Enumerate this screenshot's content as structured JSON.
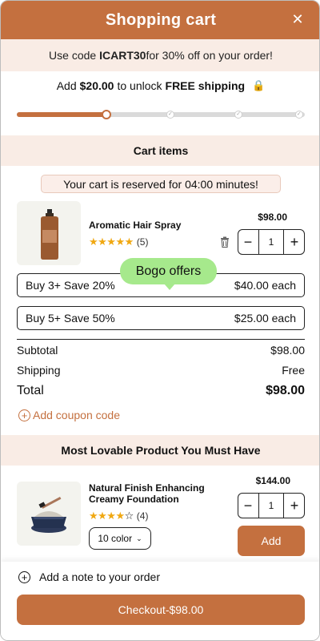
{
  "header": {
    "title": "Shopping cart",
    "close_icon": "close-icon"
  },
  "promo": {
    "prefix": "Use code ",
    "code": "ICART30",
    "suffix": " for 30% off on your order!"
  },
  "shipping": {
    "prefix": "Add",
    "amount": "$20.00",
    "middle": "to unlock",
    "emphasis": "FREE shipping",
    "icon": "lock-icon",
    "progress_percent": 31
  },
  "cart": {
    "section_title": "Cart items",
    "reserved_text": "Your cart is reserved for 04:00 minutes!",
    "item": {
      "name": "Aromatic Hair Spray",
      "rating": 5,
      "review_count": "(5)",
      "price": "$98.00",
      "quantity": "1"
    },
    "bogo_label": "Bogo offers",
    "offers": [
      {
        "label": "Buy 3+ Save 20%",
        "price": "$40.00 each"
      },
      {
        "label": "Buy 5+ Save 50%",
        "price": "$25.00 each"
      }
    ],
    "summary": {
      "subtotal_label": "Subtotal",
      "subtotal_value": "$98.00",
      "shipping_label": "Shipping",
      "shipping_value": "Free",
      "total_label": "Total",
      "total_value": "$98.00"
    },
    "coupon_label": "Add coupon code"
  },
  "recommend": {
    "section_title": "Most Lovable Product You Must Have",
    "item": {
      "name": "Natural Finish Enhancing Creamy Foundation",
      "rating": 4,
      "review_count": "(4)",
      "price": "$144.00",
      "quantity": "1",
      "color_select": "10 color",
      "add_label": "Add"
    }
  },
  "footer": {
    "note_label": "Add a note to your order",
    "checkout_label": "Checkout-$98.00"
  },
  "colors": {
    "accent": "#c4703f",
    "promo_bg": "#f9ece5",
    "bogo_bg": "#a6e98c",
    "star": "#f0a812"
  }
}
